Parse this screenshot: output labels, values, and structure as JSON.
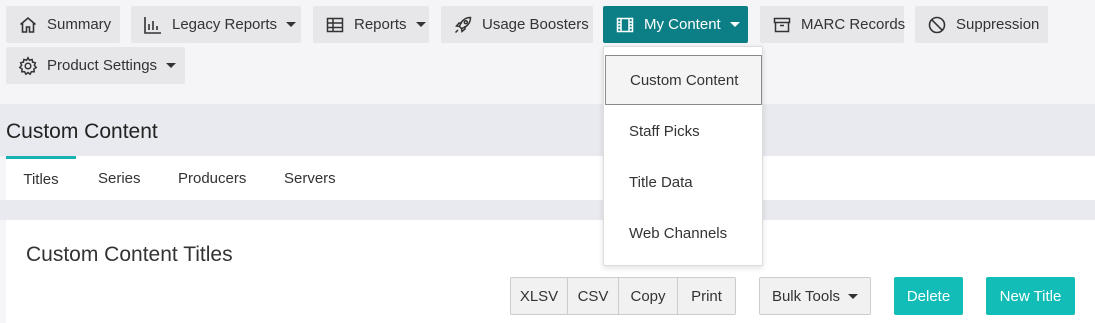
{
  "nav": {
    "items": [
      {
        "label": "Summary",
        "icon": "home-icon"
      },
      {
        "label": "Legacy Reports",
        "icon": "bar-chart-icon",
        "dropdown": true
      },
      {
        "label": "Reports",
        "icon": "table-icon",
        "dropdown": true
      },
      {
        "label": "Usage Boosters",
        "icon": "rocket-icon"
      },
      {
        "label": "My Content",
        "icon": "film-icon",
        "dropdown": true,
        "active": true
      },
      {
        "label": "MARC Records",
        "icon": "archive-icon"
      },
      {
        "label": "Suppression",
        "icon": "prohibited-icon"
      },
      {
        "label": "Product Settings",
        "icon": "gear-icon",
        "dropdown": true
      }
    ],
    "active_color": "#0c7f86"
  },
  "dropdown": {
    "items": [
      "Custom Content",
      "Staff Picks",
      "Title Data",
      "Web Channels"
    ],
    "selected": "Custom Content"
  },
  "page": {
    "title": "Custom Content"
  },
  "tabs": {
    "items": [
      "Titles",
      "Series",
      "Producers",
      "Servers"
    ],
    "active": "Titles",
    "accent_color": "#16b3b0"
  },
  "panel": {
    "title": "Custom Content Titles"
  },
  "toolbar": {
    "export_buttons": [
      "XLSV",
      "CSV",
      "Copy",
      "Print"
    ],
    "bulk_tools_label": "Bulk Tools",
    "delete_label": "Delete",
    "new_title_label": "New Title",
    "primary_color": "#12bdb8"
  }
}
